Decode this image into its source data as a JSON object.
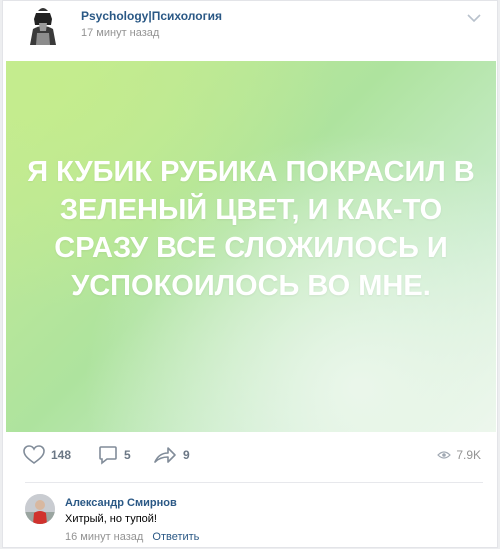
{
  "post": {
    "group_name": "Psychology|Психология",
    "time": "17 минут назад",
    "image_text": "Я КУБИК РУБИКА ПОКРАСИЛ В ЗЕЛЕНЫЙ ЦВЕТ, И КАК-ТО СРАЗУ ВСЕ СЛОЖИЛОСЬ И УСПОКОИЛОСЬ ВО МНЕ."
  },
  "actions": {
    "likes": "148",
    "comments": "5",
    "shares": "9",
    "views": "7.9K"
  },
  "comment": {
    "author": "Александр Смирнов",
    "text": "Хитрый, но тупой!",
    "time": "16 минут назад",
    "reply_label": "Ответить"
  },
  "colors": {
    "link": "#2a5885",
    "muted": "#939393",
    "icon": "#6b7785"
  }
}
